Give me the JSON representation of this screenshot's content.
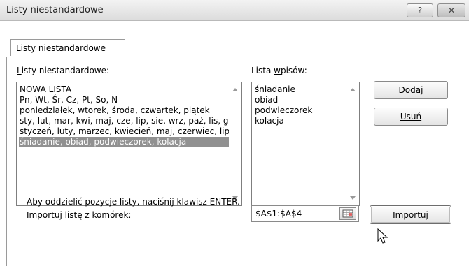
{
  "window": {
    "title": "Listy niestandardowe",
    "help_glyph": "?",
    "close_glyph": "✕"
  },
  "tabs": [
    {
      "label": "Listy niestandardowe",
      "active": true
    }
  ],
  "custom_lists": {
    "label": "Listy niestandardowe:",
    "items": [
      {
        "text": "NOWA LISTA",
        "selected": false
      },
      {
        "text": "Pn, Wt, Śr, Cz, Pt, So, N",
        "selected": false
      },
      {
        "text": "poniedziałek, wtorek, środa, czwartek, piątek",
        "selected": false
      },
      {
        "text": "sty, lut, mar, kwi, maj, cze, lip, sie, wrz, paź, lis, gru",
        "selected": false
      },
      {
        "text": "styczeń, luty, marzec, kwiecień, maj, czerwiec, lipiec",
        "selected": false
      },
      {
        "text": "śniadanie, obiad, podwieczorek, kolacja",
        "selected": true
      }
    ]
  },
  "entries": {
    "label": "Lista wpisów:",
    "items": [
      "śniadanie",
      "obiad",
      "podwieczorek",
      "kolacja"
    ]
  },
  "buttons": {
    "add": "Dodaj",
    "delete": "Usuń",
    "import": "Importuj"
  },
  "hint": "Aby oddzielić pozycje listy, naciśnij klawisz ENTER.",
  "import_range": {
    "label": "Importuj listę z komórek:",
    "value": "$A$1:$A$4"
  },
  "colors": {
    "selection": "#919191",
    "titlebar": "#dcdcdc"
  }
}
